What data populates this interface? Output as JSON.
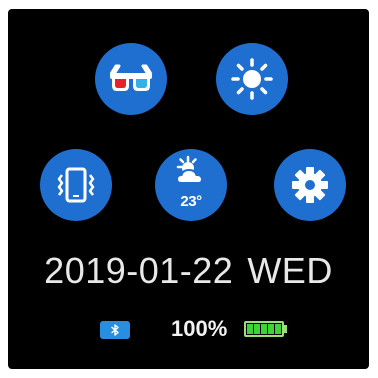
{
  "apps": {
    "three_d": {
      "icon": "3d-glasses-icon"
    },
    "brightness": {
      "icon": "sun-icon"
    },
    "vibration": {
      "icon": "phone-vibrate-icon"
    },
    "weather": {
      "icon": "partly-cloudy-icon",
      "temperature": "23°"
    },
    "settings": {
      "icon": "gear-icon"
    }
  },
  "status": {
    "date": "2019-01-22",
    "weekday": "WED",
    "bluetooth_icon": "bluetooth-icon",
    "battery_text": "100%",
    "battery_level": 1.0
  },
  "colors": {
    "background": "#000000",
    "button_blue": "#1f6fd1",
    "bluetooth_badge": "#2a8ee0",
    "battery_green": "#3fd33a"
  }
}
